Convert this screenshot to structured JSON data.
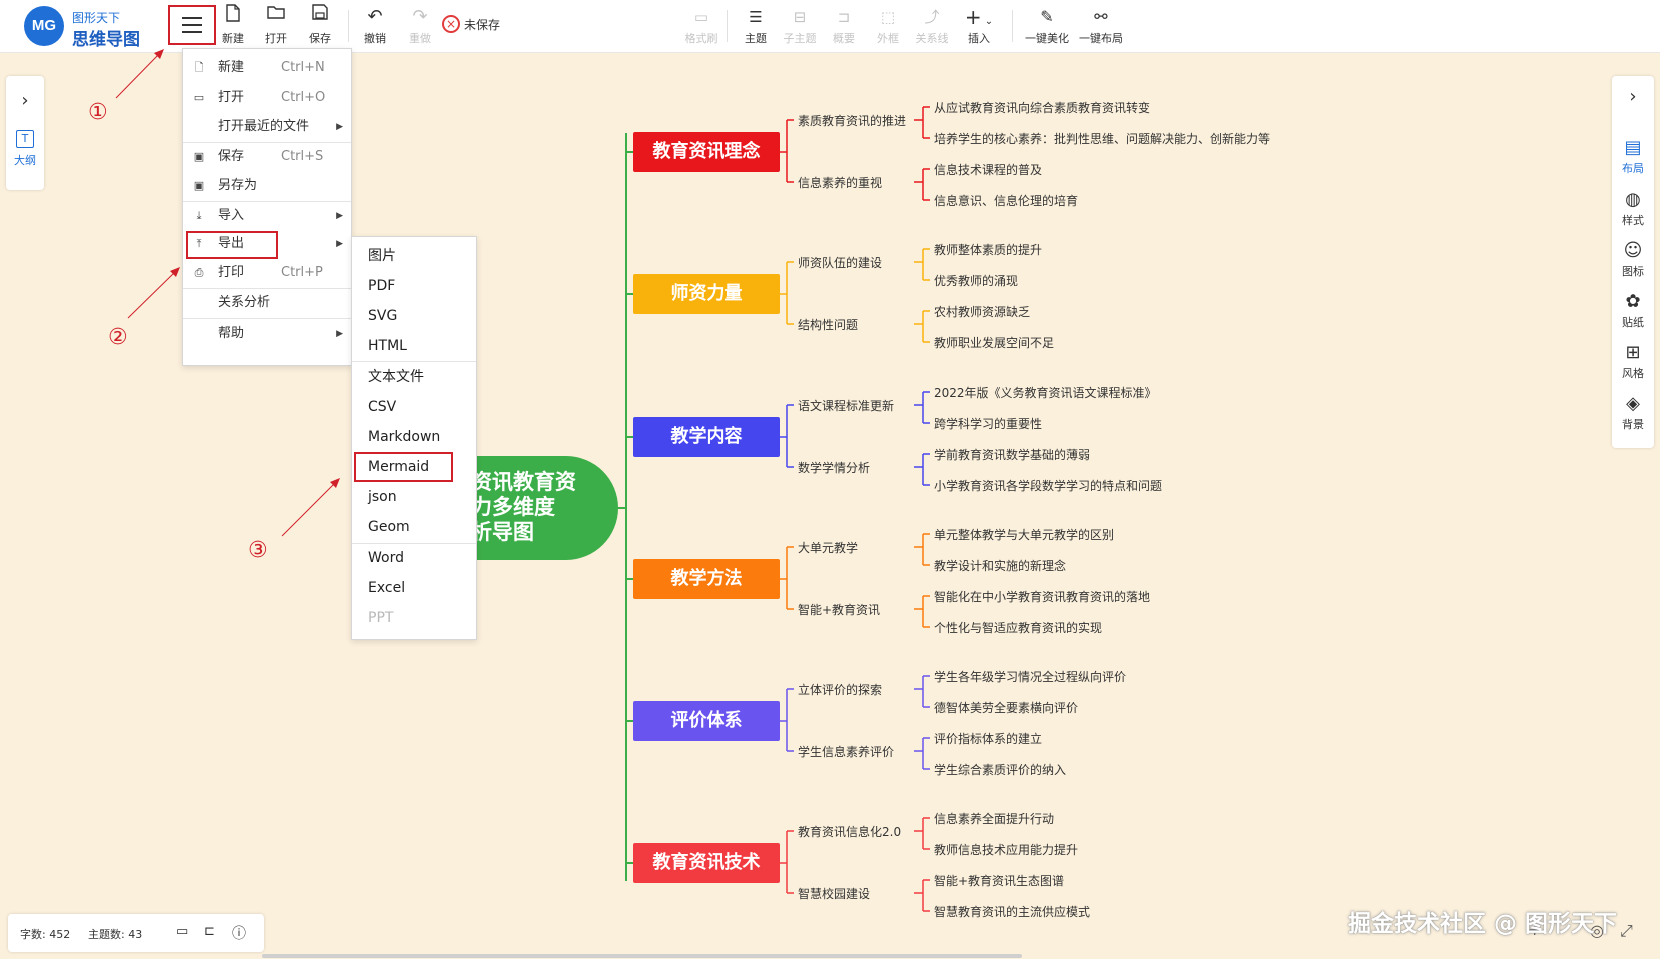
{
  "app": {
    "logo_text": "MG",
    "brand_top": "图形天下",
    "brand_name": "思维导图"
  },
  "toolbar": {
    "new": "新建",
    "open": "打开",
    "save": "保存",
    "undo": "撤销",
    "redo": "重做",
    "unsaved": "未保存",
    "format_brush": "格式刷",
    "topic": "主题",
    "subtopic": "子主题",
    "summary": "概要",
    "frame": "外框",
    "relation": "关系线",
    "insert": "插入",
    "beautify": "一键美化",
    "layout": "一键布局"
  },
  "left_panel": {
    "outline": "大纲"
  },
  "right_panel": {
    "layout": "布局",
    "style": "样式",
    "icon": "图标",
    "sticker": "贴纸",
    "theme": "风格",
    "background": "背景"
  },
  "menu": {
    "items": [
      {
        "label": "新建",
        "shortcut": "Ctrl+N"
      },
      {
        "label": "打开",
        "shortcut": "Ctrl+O"
      },
      {
        "label": "打开最近的文件",
        "shortcut": ""
      },
      {
        "label": "保存",
        "shortcut": "Ctrl+S"
      },
      {
        "label": "另存为",
        "shortcut": ""
      },
      {
        "label": "导入",
        "shortcut": ""
      },
      {
        "label": "导出",
        "shortcut": ""
      },
      {
        "label": "打印",
        "shortcut": "Ctrl+P"
      },
      {
        "label": "关系分析",
        "shortcut": ""
      },
      {
        "label": "帮助",
        "shortcut": ""
      }
    ]
  },
  "export_menu": {
    "items": [
      "图片",
      "PDF",
      "SVG",
      "HTML",
      "文本文件",
      "CSV",
      "Markdown",
      "Mermaid",
      "json",
      "Geom",
      "Word",
      "Excel",
      "PPT"
    ]
  },
  "steps": [
    "①",
    "②",
    "③"
  ],
  "mindmap": {
    "center_lines": [
      "育资讯教育资",
      "能力多维度",
      "分析导图"
    ],
    "topics": [
      {
        "label": "教育资讯理念",
        "color": "#e8171c",
        "subs": [
          {
            "label": "素质教育资讯的推进",
            "leaves": [
              "从应试教育资讯向综合素质教育资讯转变",
              "培养学生的核心素养：批判性思维、问题解决能力、创新能力等"
            ]
          },
          {
            "label": "信息素养的重视",
            "leaves": [
              "信息技术课程的普及",
              "信息意识、信息伦理的培育"
            ]
          }
        ]
      },
      {
        "label": "师资力量",
        "color": "#f9b20c",
        "subs": [
          {
            "label": "师资队伍的建设",
            "leaves": [
              "教师整体素质的提升",
              "优秀教师的涌现"
            ]
          },
          {
            "label": "结构性问题",
            "leaves": [
              "农村教师资源缺乏",
              "教师职业发展空间不足"
            ]
          }
        ]
      },
      {
        "label": "教学内容",
        "color": "#4646ee",
        "subs": [
          {
            "label": "语文课程标准更新",
            "leaves": [
              "2022年版《义务教育资讯语文课程标准》",
              "跨学科学习的重要性"
            ]
          },
          {
            "label": "数学学情分析",
            "leaves": [
              "学前教育资讯数学基础的薄弱",
              "小学教育资讯各学段数学学习的特点和问题"
            ]
          }
        ]
      },
      {
        "label": "教学方法",
        "color": "#fb7b0d",
        "subs": [
          {
            "label": "大单元教学",
            "leaves": [
              "单元整体教学与大单元教学的区别",
              "教学设计和实施的新理念"
            ]
          },
          {
            "label": "智能+教育资讯",
            "leaves": [
              "智能化在中小学教育资讯教育资讯的落地",
              "个性化与智适应教育资讯的实现"
            ]
          }
        ]
      },
      {
        "label": "评价体系",
        "color": "#6a54ef",
        "subs": [
          {
            "label": "立体评价的探索",
            "leaves": [
              "学生各年级学习情况全过程纵向评价",
              "德智体美劳全要素横向评价"
            ]
          },
          {
            "label": "学生信息素养评价",
            "leaves": [
              "评价指标体系的建立",
              "学生综合素质评价的纳入"
            ]
          }
        ]
      },
      {
        "label": "教育资讯技术",
        "color": "#f23a41",
        "subs": [
          {
            "label": "教育资讯信息化2.0",
            "leaves": [
              "信息素养全面提升行动",
              "教师信息技术应用能力提升"
            ]
          },
          {
            "label": "智慧校园建设",
            "leaves": [
              "智能+教育资讯生态图谱",
              "智慧教育资讯的主流供应模式"
            ]
          }
        ]
      }
    ]
  },
  "status": {
    "word_count": "字数: 452",
    "topic_count": "主题数: 43"
  },
  "watermark": "掘金技术社区 @ 图形天下"
}
